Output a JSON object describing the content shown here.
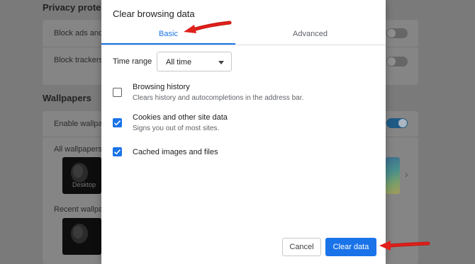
{
  "background": {
    "privacy_heading": "Privacy protect",
    "block_ads_label": "Block ads and",
    "block_trackers_label": "Block trackers",
    "wallpapers_heading": "Wallpapers",
    "enable_wallpapers_label": "Enable wallpap",
    "all_wallpapers_label": "All wallpapers",
    "desktop_thumb_label": "Desktop",
    "recent_wallpapers_label": "Recent wallpap"
  },
  "dialog": {
    "title": "Clear browsing data",
    "tabs": [
      {
        "label": "Basic",
        "active": true
      },
      {
        "label": "Advanced",
        "active": false
      }
    ],
    "time_range": {
      "label": "Time range",
      "selected": "All time"
    },
    "options": [
      {
        "title": "Browsing history",
        "subtitle": "Clears history and autocompletions in the address bar.",
        "checked": false
      },
      {
        "title": "Cookies and other site data",
        "subtitle": "Signs you out of most sites.",
        "checked": true
      },
      {
        "title": "Cached images and files",
        "subtitle": "",
        "checked": true
      }
    ],
    "buttons": {
      "cancel": "Cancel",
      "clear": "Clear data"
    }
  },
  "colors": {
    "accent": "#1a73e8",
    "annotation_arrow": "#e0201b",
    "overlay": "#7a7a7a"
  }
}
